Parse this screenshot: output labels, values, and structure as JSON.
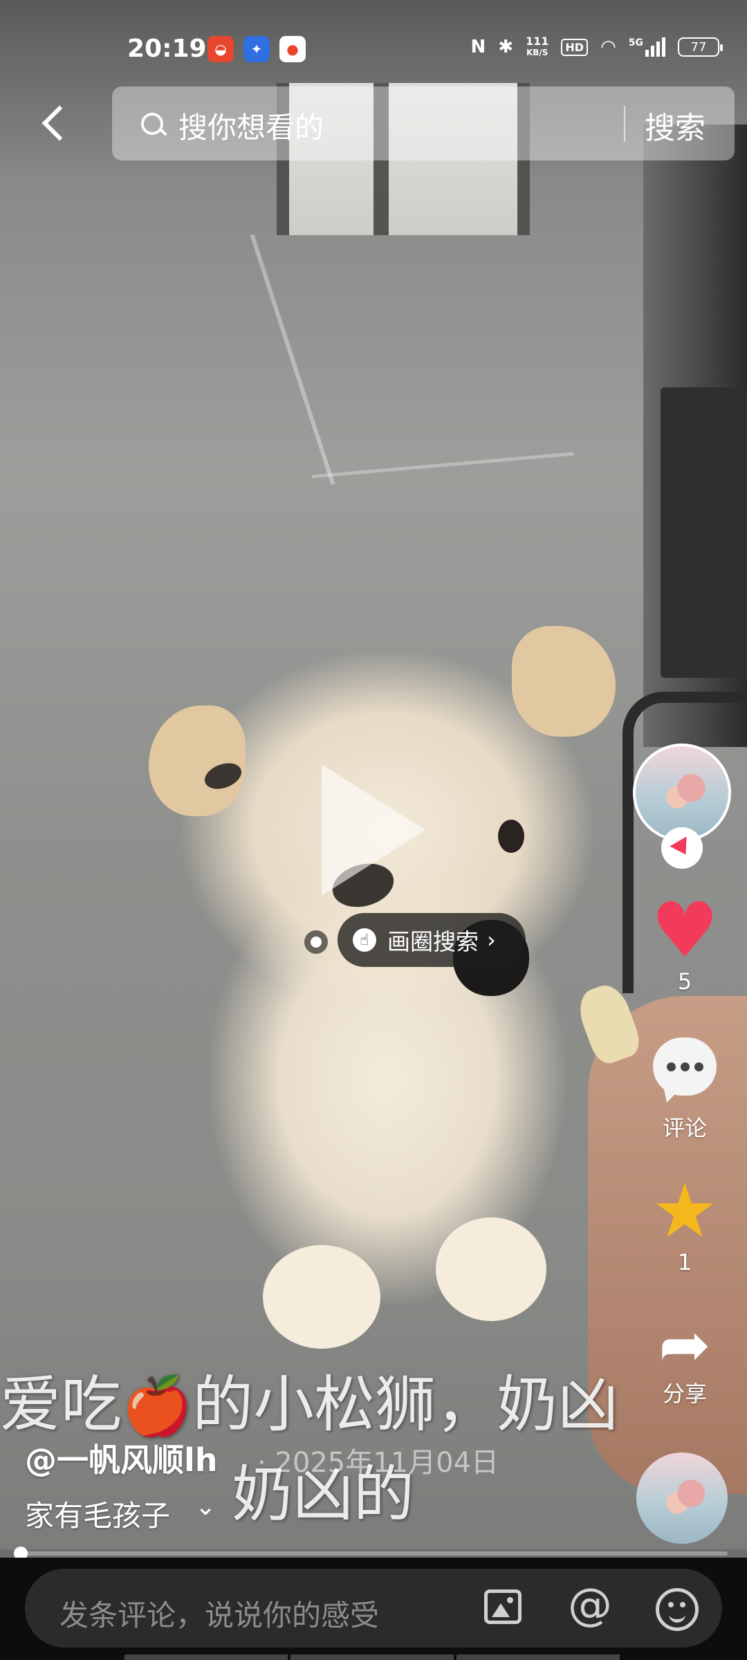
{
  "status_bar": {
    "time": "20:19",
    "network_speed_value": "111",
    "network_speed_unit": "KB/S",
    "hd_label": "HD",
    "cellular_label": "5G",
    "battery": "77"
  },
  "header": {
    "search_placeholder": "搜你想看的",
    "search_button": "搜索"
  },
  "image_search": {
    "label": "画圈搜索"
  },
  "right_rail": {
    "like_count": "5",
    "comment_label": "评论",
    "favorite_count": "1",
    "share_label": "分享"
  },
  "caption": {
    "line1_before": "爱吃",
    "line1_after": "的小松狮，奶凶",
    "line2": "奶凶的",
    "author": "@一帆风顺lh",
    "date": "· 2025年11月04日",
    "topic": "家有毛孩子"
  },
  "progress": {
    "played_fraction": 0.0
  },
  "comment_bar": {
    "placeholder": "发条评论，说说你的感受"
  },
  "colors": {
    "like": "#f23b5a",
    "favorite": "#f5b81c",
    "bottom_bar": "#0d0d0d"
  },
  "icons": [
    "back-icon",
    "search-icon",
    "play-icon",
    "circle-search-hand-icon",
    "follow-icon",
    "heart-icon",
    "comment-icon",
    "star-icon",
    "share-icon",
    "image-icon",
    "at-icon",
    "emoji-icon",
    "apple-emoji-icon"
  ]
}
